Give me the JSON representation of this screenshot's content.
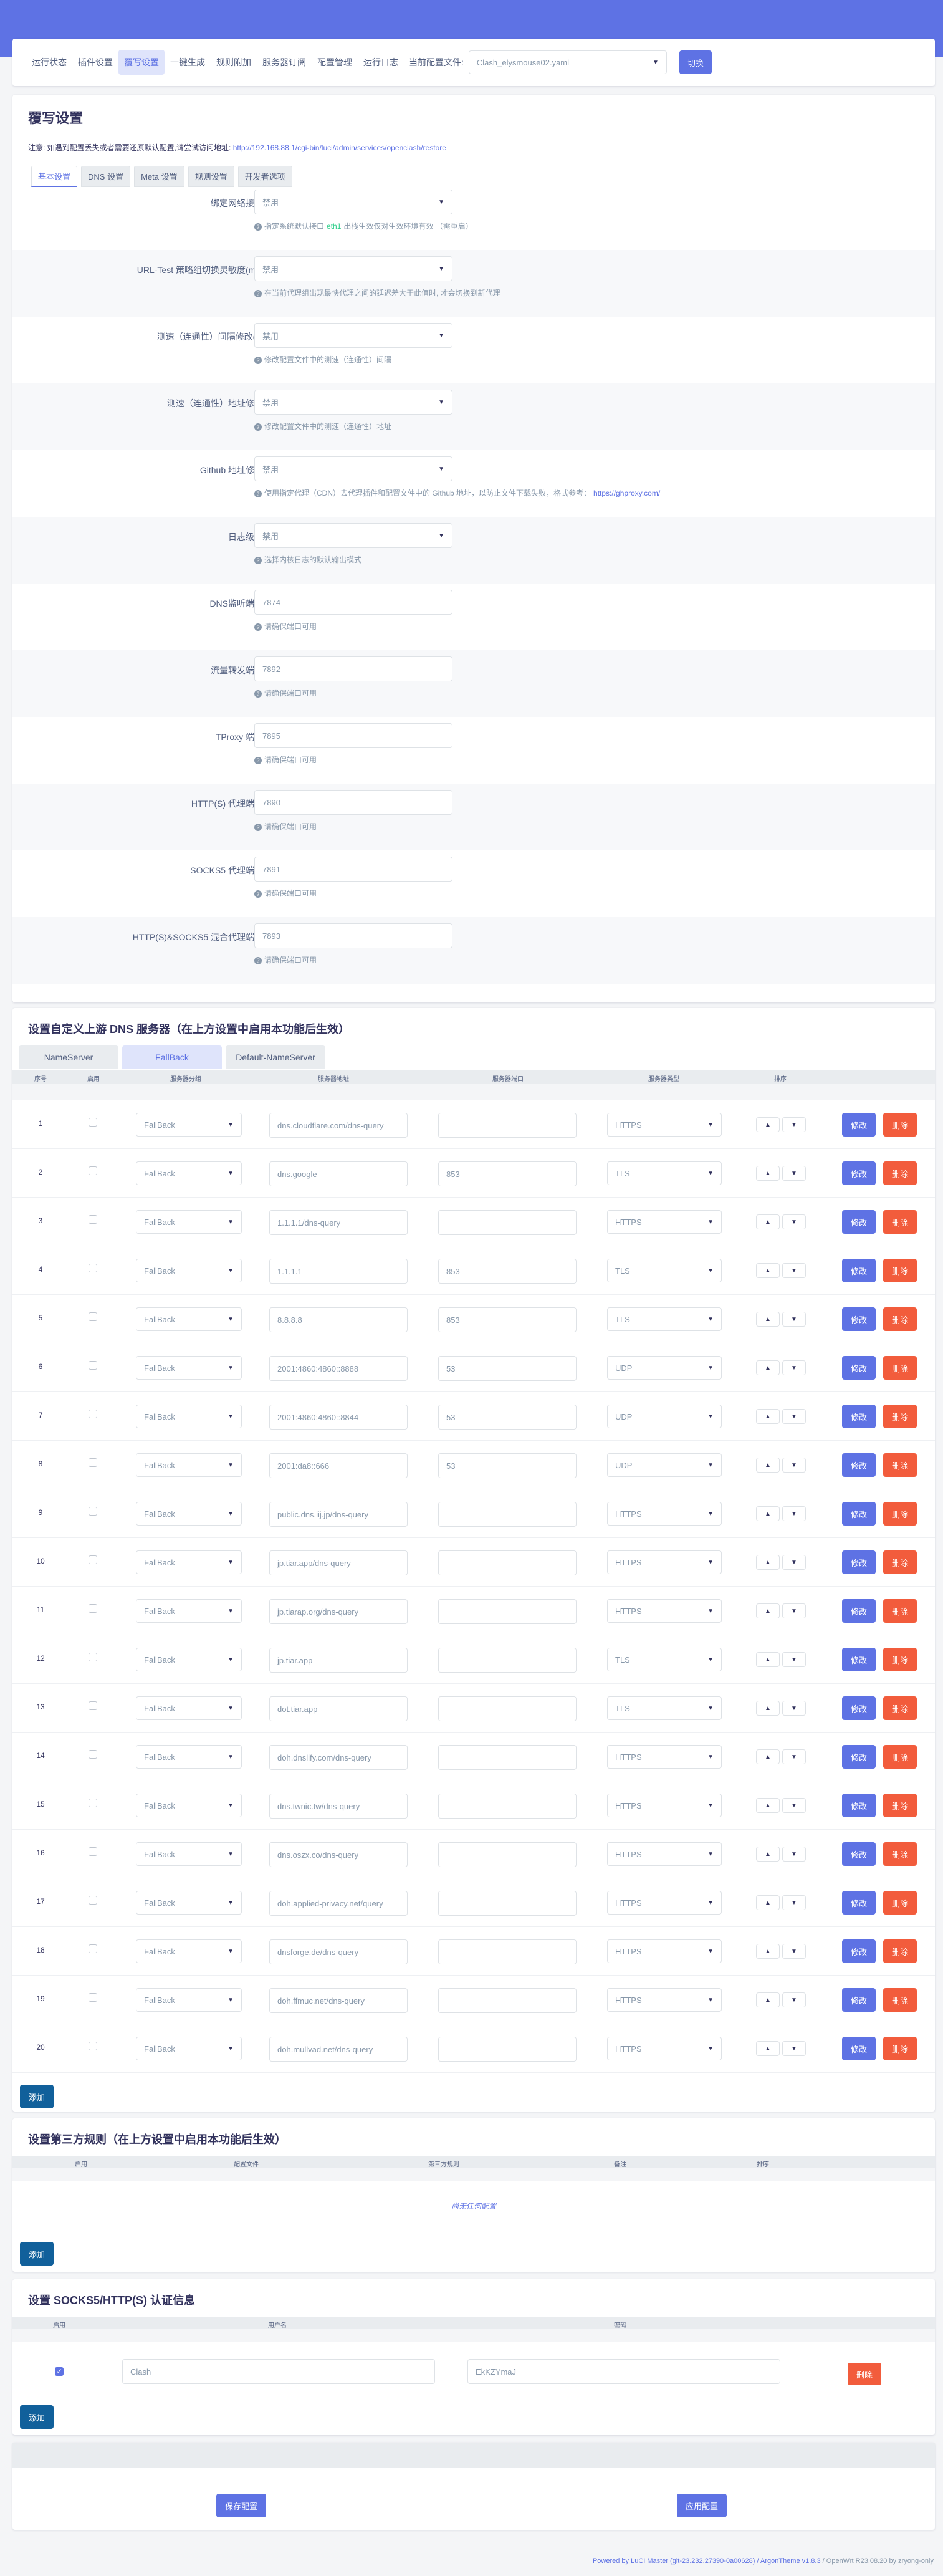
{
  "nav": {
    "tabs": [
      "运行状态",
      "插件设置",
      "覆写设置",
      "一键生成",
      "规则附加",
      "服务器订阅",
      "配置管理",
      "运行日志"
    ],
    "active": "覆写设置",
    "current_config_label": "当前配置文件:",
    "current_config_value": "Clash_elysmouse02.yaml",
    "switch_label": "切换"
  },
  "main": {
    "title": "覆写设置",
    "notice_prefix": "注意: 如遇到配置丢失或者需要还原默认配置,请尝试访问地址:",
    "notice_link": "http://192.168.88.1/cgi-bin/luci/admin/services/openclash/restore",
    "subtabs": [
      "基本设置",
      "DNS 设置",
      "Meta 设置",
      "规则设置",
      "开发者选项"
    ],
    "fields": [
      {
        "label": "绑定网络接口",
        "value": "禁用",
        "type": "select",
        "help": "指定系统默认接口",
        "help_highlight": "eth1",
        "help_suffix": "出栈生效仅对生效环境有效 （需重启）"
      },
      {
        "label": "URL-Test 策略组切换灵敏度(ms)",
        "value": "禁用",
        "type": "select",
        "help": "在当前代理组出现最快代理之间的延迟差大于此值时, 才会切换到新代理"
      },
      {
        "label": "测速（连通性）间隔修改(s)",
        "value": "禁用",
        "type": "select",
        "help": "修改配置文件中的测速（连通性）间隔"
      },
      {
        "label": "测速（连通性）地址修改",
        "value": "禁用",
        "type": "select",
        "help": "修改配置文件中的测速（连通性）地址"
      },
      {
        "label": "Github 地址修改",
        "value": "禁用",
        "type": "select",
        "help": "使用指定代理（CDN）去代理插件和配置文件中的 Github 地址，以防止文件下载失败，格式参考：",
        "help_link": "https://ghproxy.com/"
      },
      {
        "label": "日志级别",
        "value": "禁用",
        "type": "select",
        "help": "选择内核日志的默认输出模式"
      },
      {
        "label": "DNS监听端口",
        "value": "7874",
        "type": "input",
        "help": "请确保端口可用"
      },
      {
        "label": "流量转发端口",
        "value": "7892",
        "type": "input",
        "help": "请确保端口可用"
      },
      {
        "label": "TProxy 端口",
        "value": "7895",
        "type": "input",
        "help": "请确保端口可用"
      },
      {
        "label": "HTTP(S) 代理端口",
        "value": "7890",
        "type": "input",
        "help": "请确保端口可用"
      },
      {
        "label": "SOCKS5 代理端口",
        "value": "7891",
        "type": "input",
        "help": "请确保端口可用"
      },
      {
        "label": "HTTP(S)&SOCKS5 混合代理端口",
        "value": "7893",
        "type": "input",
        "help": "请确保端口可用"
      }
    ]
  },
  "dns": {
    "title": "设置自定义上游 DNS 服务器（在上方设置中启用本功能后生效）",
    "tabs": [
      "NameServer",
      "FallBack",
      "Default-NameServer"
    ],
    "active_tab": "FallBack",
    "headers": [
      "序号",
      "启用",
      "服务器分组",
      "服务器地址",
      "服务器端口",
      "服务器类型",
      "排序"
    ],
    "edit_label": "修改",
    "delete_label": "删除",
    "add_label": "添加",
    "rows": [
      {
        "n": "1",
        "group": "FallBack",
        "addr": "dns.cloudflare.com/dns-query",
        "port": "",
        "type": "HTTPS"
      },
      {
        "n": "2",
        "group": "FallBack",
        "addr": "dns.google",
        "port": "853",
        "type": "TLS"
      },
      {
        "n": "3",
        "group": "FallBack",
        "addr": "1.1.1.1/dns-query",
        "port": "",
        "type": "HTTPS"
      },
      {
        "n": "4",
        "group": "FallBack",
        "addr": "1.1.1.1",
        "port": "853",
        "type": "TLS"
      },
      {
        "n": "5",
        "group": "FallBack",
        "addr": "8.8.8.8",
        "port": "853",
        "type": "TLS"
      },
      {
        "n": "6",
        "group": "FallBack",
        "addr": "2001:4860:4860::8888",
        "port": "53",
        "type": "UDP"
      },
      {
        "n": "7",
        "group": "FallBack",
        "addr": "2001:4860:4860::8844",
        "port": "53",
        "type": "UDP"
      },
      {
        "n": "8",
        "group": "FallBack",
        "addr": "2001:da8::666",
        "port": "53",
        "type": "UDP"
      },
      {
        "n": "9",
        "group": "FallBack",
        "addr": "public.dns.iij.jp/dns-query",
        "port": "",
        "type": "HTTPS"
      },
      {
        "n": "10",
        "group": "FallBack",
        "addr": "jp.tiar.app/dns-query",
        "port": "",
        "type": "HTTPS"
      },
      {
        "n": "11",
        "group": "FallBack",
        "addr": "jp.tiarap.org/dns-query",
        "port": "",
        "type": "HTTPS"
      },
      {
        "n": "12",
        "group": "FallBack",
        "addr": "jp.tiar.app",
        "port": "",
        "type": "TLS"
      },
      {
        "n": "13",
        "group": "FallBack",
        "addr": "dot.tiar.app",
        "port": "",
        "type": "TLS"
      },
      {
        "n": "14",
        "group": "FallBack",
        "addr": "doh.dnslify.com/dns-query",
        "port": "",
        "type": "HTTPS"
      },
      {
        "n": "15",
        "group": "FallBack",
        "addr": "dns.twnic.tw/dns-query",
        "port": "",
        "type": "HTTPS"
      },
      {
        "n": "16",
        "group": "FallBack",
        "addr": "dns.oszx.co/dns-query",
        "port": "",
        "type": "HTTPS"
      },
      {
        "n": "17",
        "group": "FallBack",
        "addr": "doh.applied-privacy.net/query",
        "port": "",
        "type": "HTTPS"
      },
      {
        "n": "18",
        "group": "FallBack",
        "addr": "dnsforge.de/dns-query",
        "port": "",
        "type": "HTTPS"
      },
      {
        "n": "19",
        "group": "FallBack",
        "addr": "doh.ffmuc.net/dns-query",
        "port": "",
        "type": "HTTPS"
      },
      {
        "n": "20",
        "group": "FallBack",
        "addr": "doh.mullvad.net/dns-query",
        "port": "",
        "type": "HTTPS"
      }
    ]
  },
  "third": {
    "title": "设置第三方规则（在上方设置中启用本功能后生效）",
    "headers": [
      "启用",
      "配置文件",
      "第三方规则",
      "备注",
      "排序"
    ],
    "empty": "尚无任何配置",
    "add_label": "添加"
  },
  "socks": {
    "title": "设置 SOCKS5/HTTP(S) 认证信息",
    "headers": [
      "启用",
      "用户名",
      "密码"
    ],
    "username": "Clash",
    "password": "EkKZYmaJ",
    "delete_label": "删除",
    "add_label": "添加"
  },
  "footer": {
    "save_label": "保存配置",
    "apply_label": "应用配置",
    "copyright_link": "Powered by LuCI Master (git-23.232.27390-0a00628) / ArgonTheme v1.8.3",
    "copyright_rest": " / OpenWrt R23.08.20 by zryong-only"
  },
  "colors": {
    "accent": "#5e72e4",
    "danger": "#f5365c",
    "add": "#11609b"
  }
}
